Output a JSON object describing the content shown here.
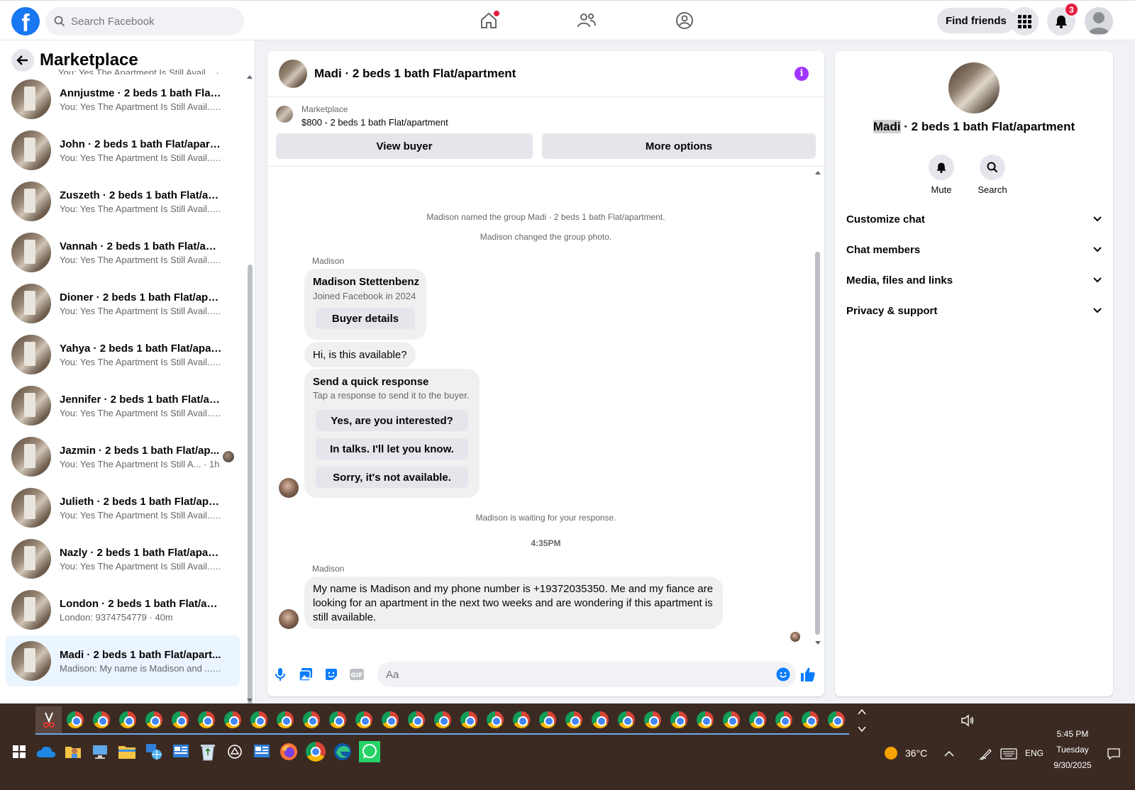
{
  "topbar": {
    "search_placeholder": "Search Facebook",
    "find_friends": "Find friends",
    "notifications_count": "3"
  },
  "left": {
    "title": "Marketplace",
    "partial_preview": "You: Yes The Apartment Is Still Avail... · 1h",
    "conversations": [
      {
        "name": "Annjustme · 2 beds 1 bath Flat/a...",
        "preview": "You: Yes The Apartment Is Still Avail... · 1h"
      },
      {
        "name": "John · 2 beds 1 bath Flat/apartm...",
        "preview": "You: Yes The Apartment Is Still Avail... · 1h"
      },
      {
        "name": "Zuszeth · 2 beds 1 bath Flat/apar...",
        "preview": "You: Yes The Apartment Is Still Avail... · 1h"
      },
      {
        "name": "Vannah · 2 beds 1 bath Flat/apar...",
        "preview": "You: Yes The Apartment Is Still Avail... · 1h"
      },
      {
        "name": "Dioner · 2 beds 1 bath Flat/apart...",
        "preview": "You: Yes The Apartment Is Still Avail... · 1h"
      },
      {
        "name": "Yahya · 2 beds 1 bath Flat/apart...",
        "preview": "You: Yes The Apartment Is Still Avail... · 1h"
      },
      {
        "name": "Jennifer · 2 beds 1 bath Flat/apa...",
        "preview": "You: Yes The Apartment Is Still Avail... · 1h"
      },
      {
        "name": "Jazmin · 2 beds 1 bath Flat/ap...",
        "preview": "You: Yes The Apartment Is Still A... · 1h"
      },
      {
        "name": "Julieth · 2 beds 1 bath Flat/apart...",
        "preview": "You: Yes The Apartment Is Still Avail... · 1h"
      },
      {
        "name": "Nazly · 2 beds 1 bath Flat/apart...",
        "preview": "You: Yes The Apartment Is Still Avail... · 1h"
      },
      {
        "name": "London · 2 beds 1 bath Flat/apar...",
        "preview": "London: 9374754779 · 40m"
      },
      {
        "name": "Madi · 2 beds 1 bath Flat/apart...",
        "preview": "Madison: My name is Madison and ... · 1h"
      }
    ]
  },
  "chat": {
    "title": "Madi · 2 beds 1 bath Flat/apartment",
    "listing_source": "Marketplace",
    "listing_price": "$800 - 2 beds 1 bath Flat/apartment",
    "view_buyer": "View buyer",
    "more_options": "More options",
    "sys_named": "Madison named the group Madi · 2 beds 1 bath Flat/apartment.",
    "sys_photo": "Madison changed the group photo.",
    "sender": "Madison",
    "profile_name": "Madison Stettenbenz",
    "profile_joined": "Joined Facebook in 2024",
    "buyer_details": "Buyer details",
    "msg_available": "Hi, is this available?",
    "quick_title": "Send a quick response",
    "quick_sub": "Tap a response to send it to the buyer.",
    "quick_1": "Yes, are you interested?",
    "quick_2": "In talks. I'll let you know.",
    "quick_3": "Sorry, it's not available.",
    "sys_waiting": "Madison is waiting for your response.",
    "time": "4:35PM",
    "sender2": "Madison",
    "msg_long": "My name is Madison and my phone number is +19372035350. Me and my fiance are looking for an apartment in the next two weeks and are wondering if this apartment is still available.",
    "composer_placeholder": "Aa"
  },
  "right": {
    "name_highlight": "Madi",
    "name_rest": " · 2 beds 1 bath Flat/apartment",
    "mute": "Mute",
    "search": "Search",
    "sections": [
      "Customize chat",
      "Chat members",
      "Media, files and links",
      "Privacy & support"
    ]
  },
  "taskbar": {
    "temp": "36°C",
    "lang": "ENG",
    "time": "5:45 PM",
    "day": "Tuesday",
    "date": "9/30/2025"
  }
}
